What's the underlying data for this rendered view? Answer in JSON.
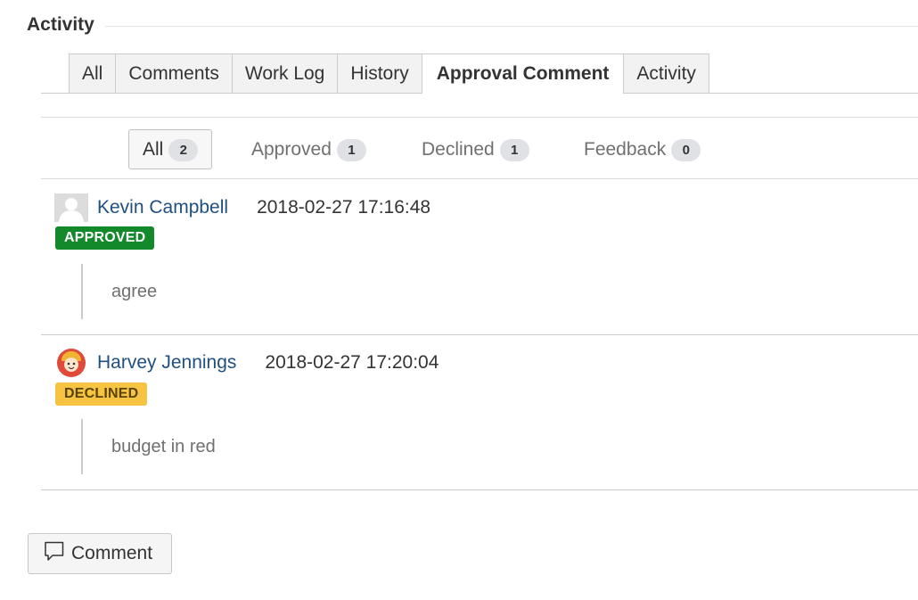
{
  "section": {
    "title": "Activity"
  },
  "tabs": [
    {
      "label": "All",
      "active": false
    },
    {
      "label": "Comments",
      "active": false
    },
    {
      "label": "Work Log",
      "active": false
    },
    {
      "label": "History",
      "active": false
    },
    {
      "label": "Approval Comment",
      "active": true
    },
    {
      "label": "Activity",
      "active": false
    }
  ],
  "filters": [
    {
      "label": "All",
      "count": "2",
      "active": true
    },
    {
      "label": "Approved",
      "count": "1",
      "active": false
    },
    {
      "label": "Declined",
      "count": "1",
      "active": false
    },
    {
      "label": "Feedback",
      "count": "0",
      "active": false
    }
  ],
  "entries": [
    {
      "author": "Kevin Campbell",
      "timestamp": "2018-02-27 17:16:48",
      "status": "APPROVED",
      "status_color": "#14892c",
      "comment": "agree",
      "avatar_icon": "default-user-avatar"
    },
    {
      "author": "Harvey Jennings",
      "timestamp": "2018-02-27 17:20:04",
      "status": "DECLINED",
      "status_color": "#f6c342",
      "comment": "budget in red",
      "avatar_icon": "cartoon-user-avatar"
    }
  ],
  "actions": {
    "comment_label": "Comment",
    "comment_icon": "speech-bubble-icon"
  },
  "colors": {
    "link": "#205081",
    "approved": "#14892c",
    "declined": "#f6c342"
  }
}
